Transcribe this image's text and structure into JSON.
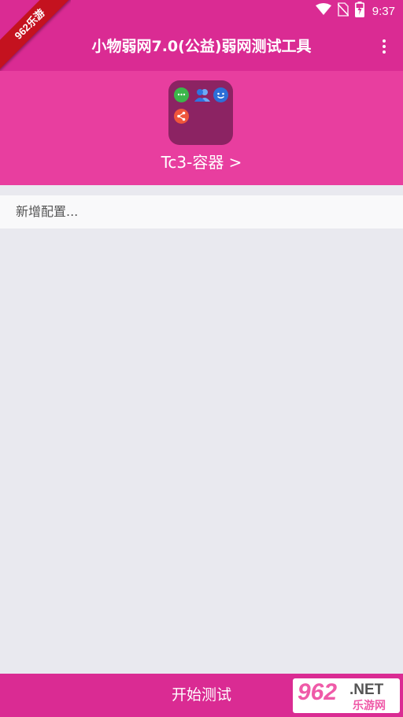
{
  "status_bar": {
    "time": "9:37",
    "icons": [
      "wifi-icon",
      "no-sim-icon",
      "battery-charging-icon"
    ]
  },
  "watermark": {
    "ribbon_text": "962乐游",
    "logo_number": "962",
    "logo_domain": ".NET",
    "logo_subtext": "乐游网"
  },
  "toolbar": {
    "title": "小物弱网7.0(公益)弱网测试工具",
    "menu_icon": "more-vert-icon"
  },
  "header": {
    "folder_icons": [
      "chat-icon",
      "contacts-icon",
      "face-icon",
      "share-icon"
    ],
    "container_label": "Tc3-容器 >"
  },
  "list": {
    "items": [
      {
        "label": "新增配置..."
      }
    ]
  },
  "bottom": {
    "start_label": "开始测试"
  },
  "colors": {
    "toolbar": "#da2b93",
    "header": "#e83e9f",
    "folder": "#8c2363",
    "background": "#e9e9ef"
  }
}
